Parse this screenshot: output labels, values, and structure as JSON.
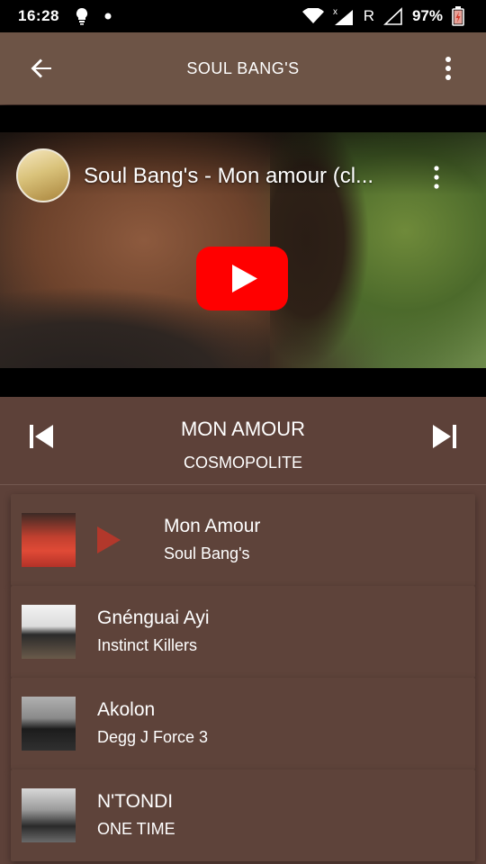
{
  "status_bar": {
    "time": "16:28",
    "carrier_label": "R",
    "battery": "97%"
  },
  "app_bar": {
    "title": "SOUL BANG'S"
  },
  "video": {
    "title": "Soul Bang's - Mon amour (cl..."
  },
  "now_playing": {
    "title": "MON AMOUR",
    "album": "COSMOPOLITE"
  },
  "playlist": [
    {
      "title": "Mon Amour",
      "artist": "Soul Bang's",
      "active": true
    },
    {
      "title": "Gnénguai Ayi",
      "artist": "Instinct Killers",
      "active": false
    },
    {
      "title": "Akolon",
      "artist": "Degg J Force 3",
      "active": false
    },
    {
      "title": "N'TONDI",
      "artist": "ONE TIME",
      "active": false
    }
  ],
  "colors": {
    "background": "#5d4139",
    "app_bar": "#6d5446",
    "youtube_red": "#ff0000",
    "playing_indicator": "#b2382b"
  }
}
